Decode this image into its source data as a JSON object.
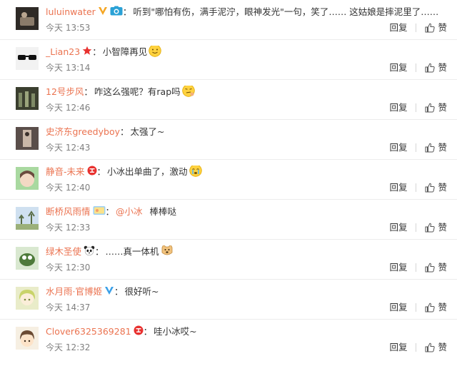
{
  "comments": [
    {
      "username": "luluinwater",
      "text": "听到\"哪怕有伤，满手泥泞，眼神发光\"一句，笑了…… 这姑娘是摔泥里了……",
      "time": "今天 13:53",
      "badges": [
        "verified-yellow-v-icon",
        "camera-badge-icon"
      ],
      "avatar": {
        "bg": "#2e2a26",
        "fg": "#8a7b6a"
      }
    },
    {
      "username": "_Lian23",
      "text": "小智障再见",
      "time": "今天 13:14",
      "badges": [
        "red-star-badge-icon"
      ],
      "emoji": "smile-emoji-icon",
      "avatar": {
        "bg": "#f2f2f2",
        "fg": "#111111"
      }
    },
    {
      "username": "12号步风",
      "text": "咋这么强呢？有rap吗",
      "time": "今天 12:46",
      "badges": [],
      "emoji": "thinking-emoji-icon",
      "avatar": {
        "bg": "#3b3f2f",
        "fg": "#7f8a66"
      }
    },
    {
      "username": "史济东greedyboy",
      "text": "太强了~",
      "time": "今天 12:43",
      "badges": [],
      "avatar": {
        "bg": "#5a4e4a",
        "fg": "#c9b7a8"
      }
    },
    {
      "username": "静音-未来",
      "text": "小冰出单曲了，激动",
      "time": "今天 12:40",
      "badges": [
        "red-circle-badge-icon"
      ],
      "emoji": "crying-emoji-icon",
      "avatar": {
        "bg": "#a9d9a0",
        "fg": "#6b4b3e"
      }
    },
    {
      "username": "断桥风雨情",
      "mention": "@小冰",
      "text": "棒棒哒",
      "time": "今天 12:33",
      "badges": [
        "member-banner-badge-icon"
      ],
      "avatar": {
        "bg": "#cfe0f0",
        "fg": "#5a6e48"
      }
    },
    {
      "username": "绿木圣使",
      "text": "……真一体机",
      "time": "今天 12:30",
      "badges": [
        "panda-badge-icon"
      ],
      "emoji": "doge-emoji-icon",
      "avatar": {
        "bg": "#d9e8d0",
        "fg": "#4d7a3a"
      }
    },
    {
      "username": "水月雨·官博姬",
      "text": "很好听~",
      "time": "今天 14:37",
      "badges": [
        "verified-blue-v-icon"
      ],
      "avatar": {
        "bg": "#e9ecc9",
        "fg": "#7a8a3e"
      }
    },
    {
      "username": "Clover6325369281",
      "text": "哇小冰哎~",
      "time": "今天 12:32",
      "badges": [
        "red-circle-badge-icon"
      ],
      "avatar": {
        "bg": "#f6efe2",
        "fg": "#6b4a32"
      }
    }
  ],
  "actions": {
    "reply_label": "回复",
    "like_label": "赞"
  },
  "colors": {
    "username": "#eb7350",
    "text": "#333333",
    "time": "#808080",
    "divider": "#ececec"
  }
}
